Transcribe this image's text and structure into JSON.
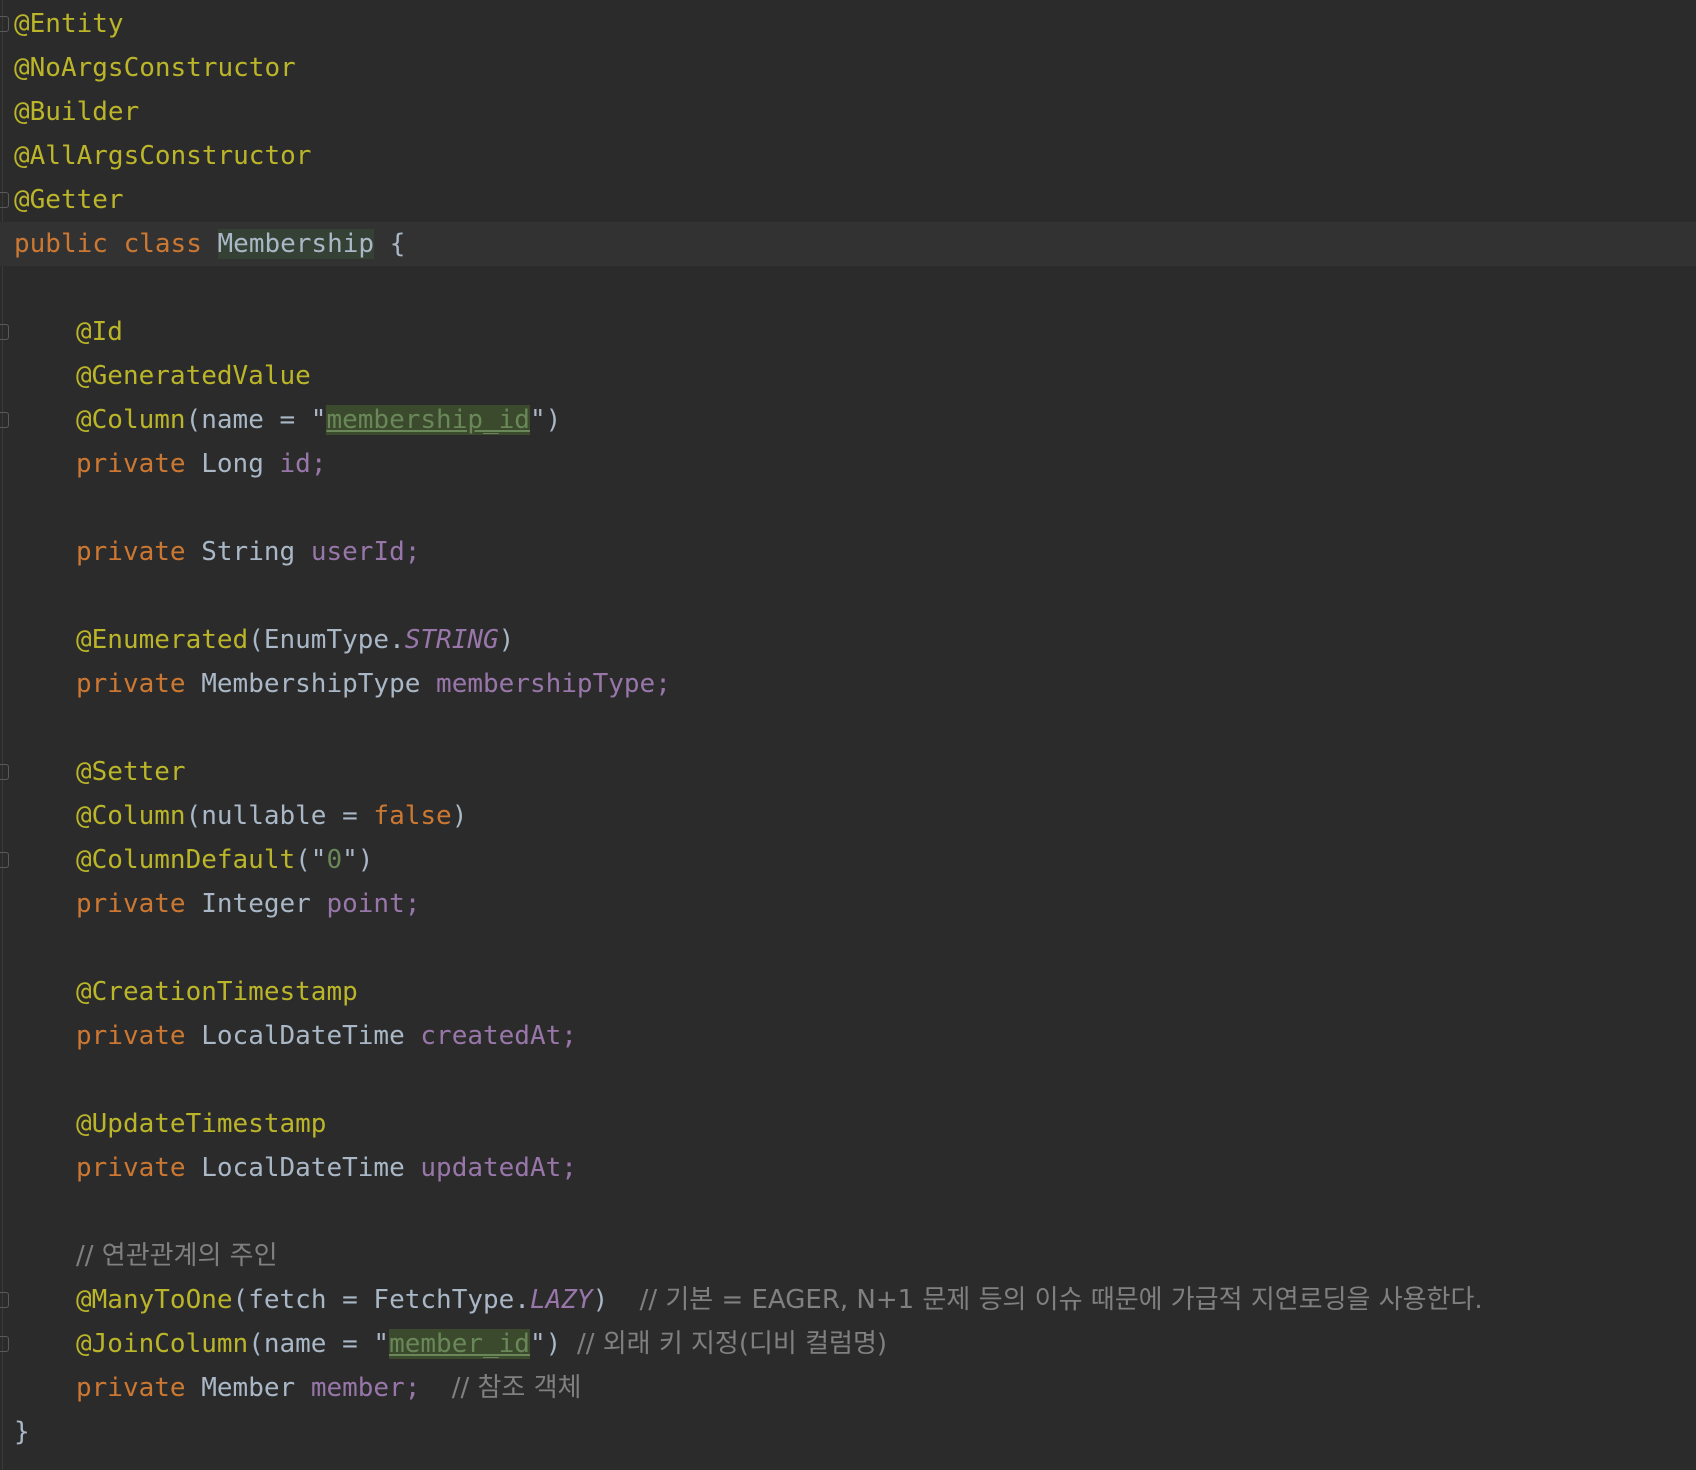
{
  "editor": {
    "lines": {
      "l1": "@Entity",
      "l2": "@NoArgsConstructor",
      "l3": "@Builder",
      "l4": "@AllArgsConstructor",
      "l5": "@Getter",
      "l6": {
        "kw_public": "public",
        "kw_class": "class",
        "class_name": "Membership",
        "brace": "{"
      },
      "l8": "@Id",
      "l9": "@GeneratedValue",
      "l10": {
        "ann": "@Column",
        "open": "(name = \"",
        "str": "membership_id",
        "close": "\")"
      },
      "l11": {
        "kw": "private",
        "type": "Long",
        "field": "id;"
      },
      "l13": {
        "kw": "private",
        "type": "String",
        "field": "userId;"
      },
      "l15": {
        "ann": "@Enumerated",
        "open": "(EnumType.",
        "const": "STRING",
        "close": ")"
      },
      "l16": {
        "kw": "private",
        "type": "MembershipType",
        "field": "membershipType;"
      },
      "l18": "@Setter",
      "l19": {
        "ann": "@Column",
        "open": "(nullable = ",
        "kw": "false",
        "close": ")"
      },
      "l20": {
        "ann": "@ColumnDefault",
        "open": "(\"",
        "str": "0",
        "close": "\")"
      },
      "l21": {
        "kw": "private",
        "type": "Integer",
        "field": "point;"
      },
      "l23": "@CreationTimestamp",
      "l24": {
        "kw": "private",
        "type": "LocalDateTime",
        "field": "createdAt;"
      },
      "l26": "@UpdateTimestamp",
      "l27": {
        "kw": "private",
        "type": "LocalDateTime",
        "field": "updatedAt;"
      },
      "l29": "// 연관관계의 주인",
      "l30": {
        "ann": "@ManyToOne",
        "open": "(fetch = FetchType.",
        "const": "LAZY",
        "close": ")",
        "comment": "// 기본 = EAGER, N+1 문제 등의 이슈 때문에 가급적 지연로딩을 사용한다."
      },
      "l31": {
        "ann": "@JoinColumn",
        "open": "(name = \"",
        "str": "member_id",
        "close": "\")",
        "comment": "// 외래 키 지정(디비 컬럼명)"
      },
      "l32": {
        "kw": "private",
        "type": "Member",
        "field": "member;",
        "comment": "// 참조 객체"
      },
      "l33": "}"
    },
    "colors": {
      "background": "#2b2b2b",
      "annotation": "#bbb529",
      "keyword": "#cc7832",
      "field": "#9876aa",
      "string": "#6a8759",
      "comment": "#808080",
      "text": "#a9b7c6"
    }
  }
}
